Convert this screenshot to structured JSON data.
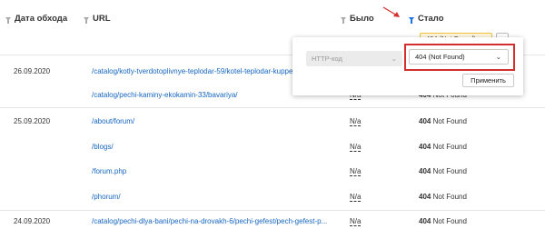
{
  "header": {
    "col_date": "Дата обхода",
    "col_url": "URL",
    "col_bylo": "Было",
    "col_stalo": "Стало",
    "stalo_filter_chip": "404 (Not Found)",
    "chip_toggle": "⌄"
  },
  "groups": [
    {
      "date": "26.09.2020",
      "rows": [
        {
          "url": "/catalog/kotly-tverdotoplivnye-teplodar-59/kotel-teplodar-kupper-..."
        },
        {
          "url": "/catalog/pechi-kaminy-ekokamin-33/bavariya/",
          "bylo": "N/a",
          "stalo_code": "404",
          "stalo_text": "Not Found"
        }
      ]
    },
    {
      "date": "25.09.2020",
      "rows": [
        {
          "url": "/about/forum/",
          "bylo": "N/a",
          "stalo_code": "404",
          "stalo_text": "Not Found"
        },
        {
          "url": "/blogs/",
          "bylo": "N/a",
          "stalo_code": "404",
          "stalo_text": "Not Found"
        },
        {
          "url": "/forum.php",
          "bylo": "N/a",
          "stalo_code": "404",
          "stalo_text": "Not Found"
        },
        {
          "url": "/phorum/",
          "bylo": "N/a",
          "stalo_code": "404",
          "stalo_text": "Not Found"
        }
      ]
    },
    {
      "date": "24.09.2020",
      "rows": [
        {
          "url": "/catalog/pechi-dlya-bani/pechi-na-drovakh-6/pechi-gefest/pech-gefest-p...",
          "bylo": "N/a",
          "stalo_code": "404",
          "stalo_text": "Not Found"
        }
      ]
    }
  ],
  "popup": {
    "field_select": "HTTP-код",
    "value_select": "404 (Not Found)",
    "apply": "Применить"
  },
  "colors": {
    "link": "#1565c0",
    "accent": "#1a73e8",
    "highlight": "#d32f2f",
    "chip_border": "#f0c23a"
  }
}
